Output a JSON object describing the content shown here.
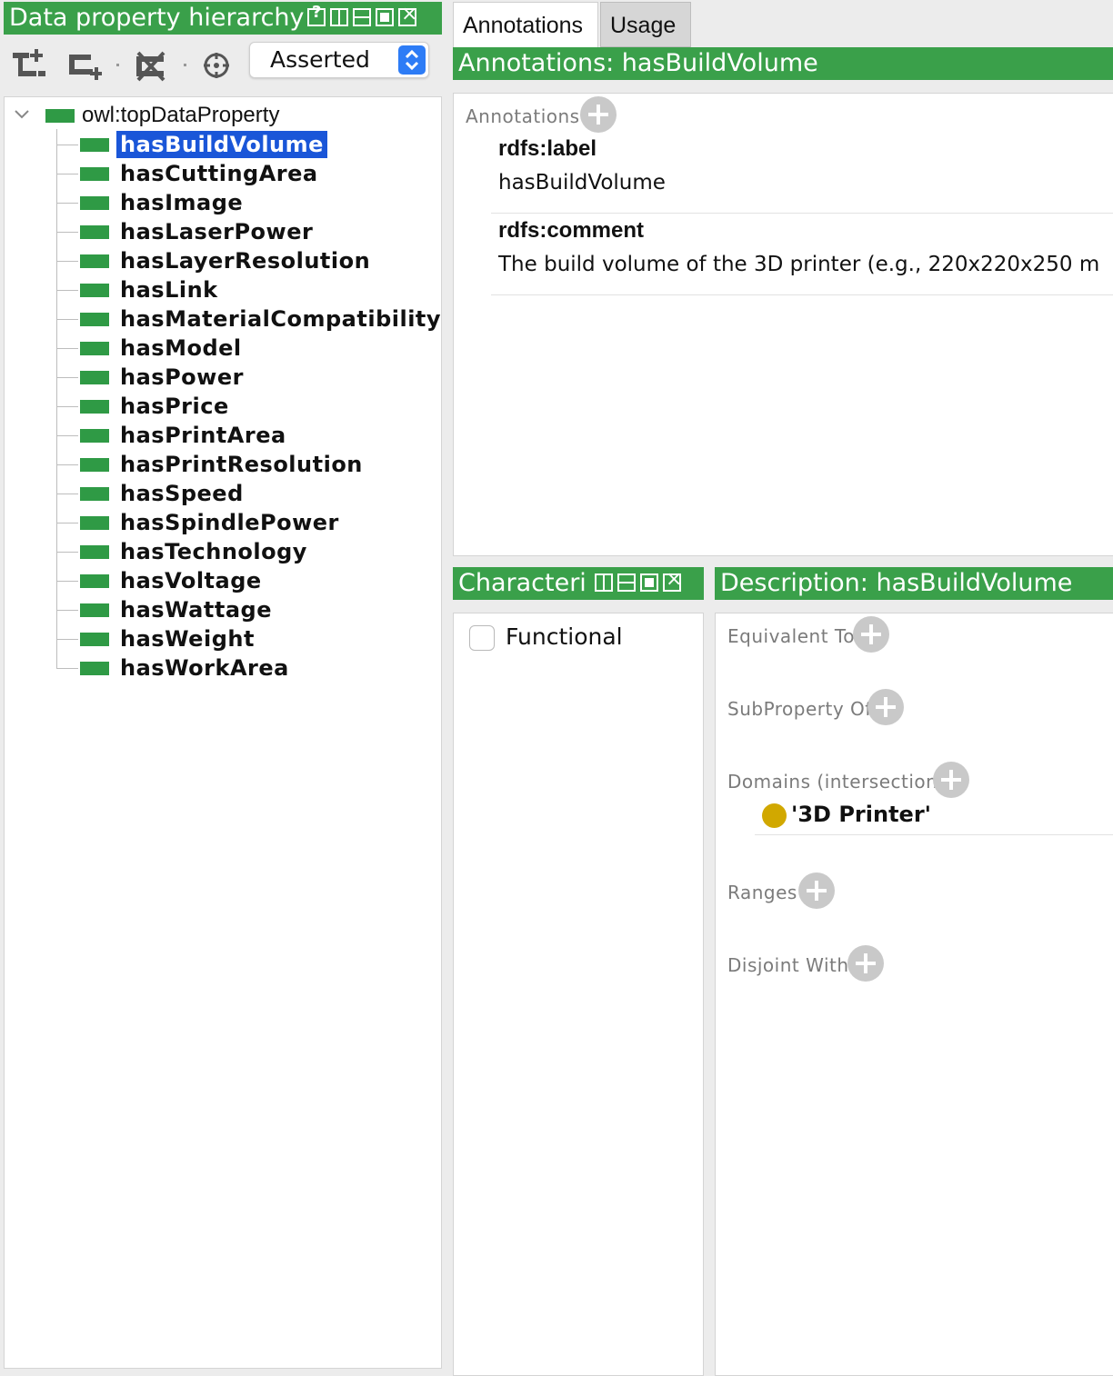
{
  "hierarchy": {
    "title": "Data property hierarchy",
    "mode": "Asserted",
    "root": "owl:topDataProperty",
    "items": [
      "hasBuildVolume",
      "hasCuttingArea",
      "hasImage",
      "hasLaserPower",
      "hasLayerResolution",
      "hasLink",
      "hasMaterialCompatibility",
      "hasModel",
      "hasPower",
      "hasPrice",
      "hasPrintArea",
      "hasPrintResolution",
      "hasSpeed",
      "hasSpindlePower",
      "hasTechnology",
      "hasVoltage",
      "hasWattage",
      "hasWeight",
      "hasWorkArea"
    ],
    "selected": "hasBuildVolume",
    "toolbar_icons": [
      "add-subproperty-icon",
      "add-sibling-property-icon",
      "delete-property-icon",
      "crosshair-icon"
    ]
  },
  "tabs": [
    "Annotations",
    "Usage"
  ],
  "annotations": {
    "header": "Annotations: hasBuildVolume",
    "section_label": "Annotations",
    "label_prop": "rdfs:label",
    "label_value": "hasBuildVolume",
    "comment_prop": "rdfs:comment",
    "comment_value": "The build volume of the 3D printer (e.g., 220x220x250 m"
  },
  "characteristics": {
    "header": "Characteri",
    "functional_label": "Functional",
    "functional_checked": false
  },
  "description": {
    "header": "Description: hasBuildVolume",
    "equivalent_to": "Equivalent To",
    "subproperty_of": "SubProperty Of",
    "domains": "Domains (intersection)",
    "domain_value": "'3D Printer'",
    "ranges": "Ranges",
    "disjoint_with": "Disjoint With"
  },
  "colors": {
    "header_green": "#3aa04a",
    "selection_blue": "#1a56d8",
    "class_dot": "#d1a800"
  }
}
